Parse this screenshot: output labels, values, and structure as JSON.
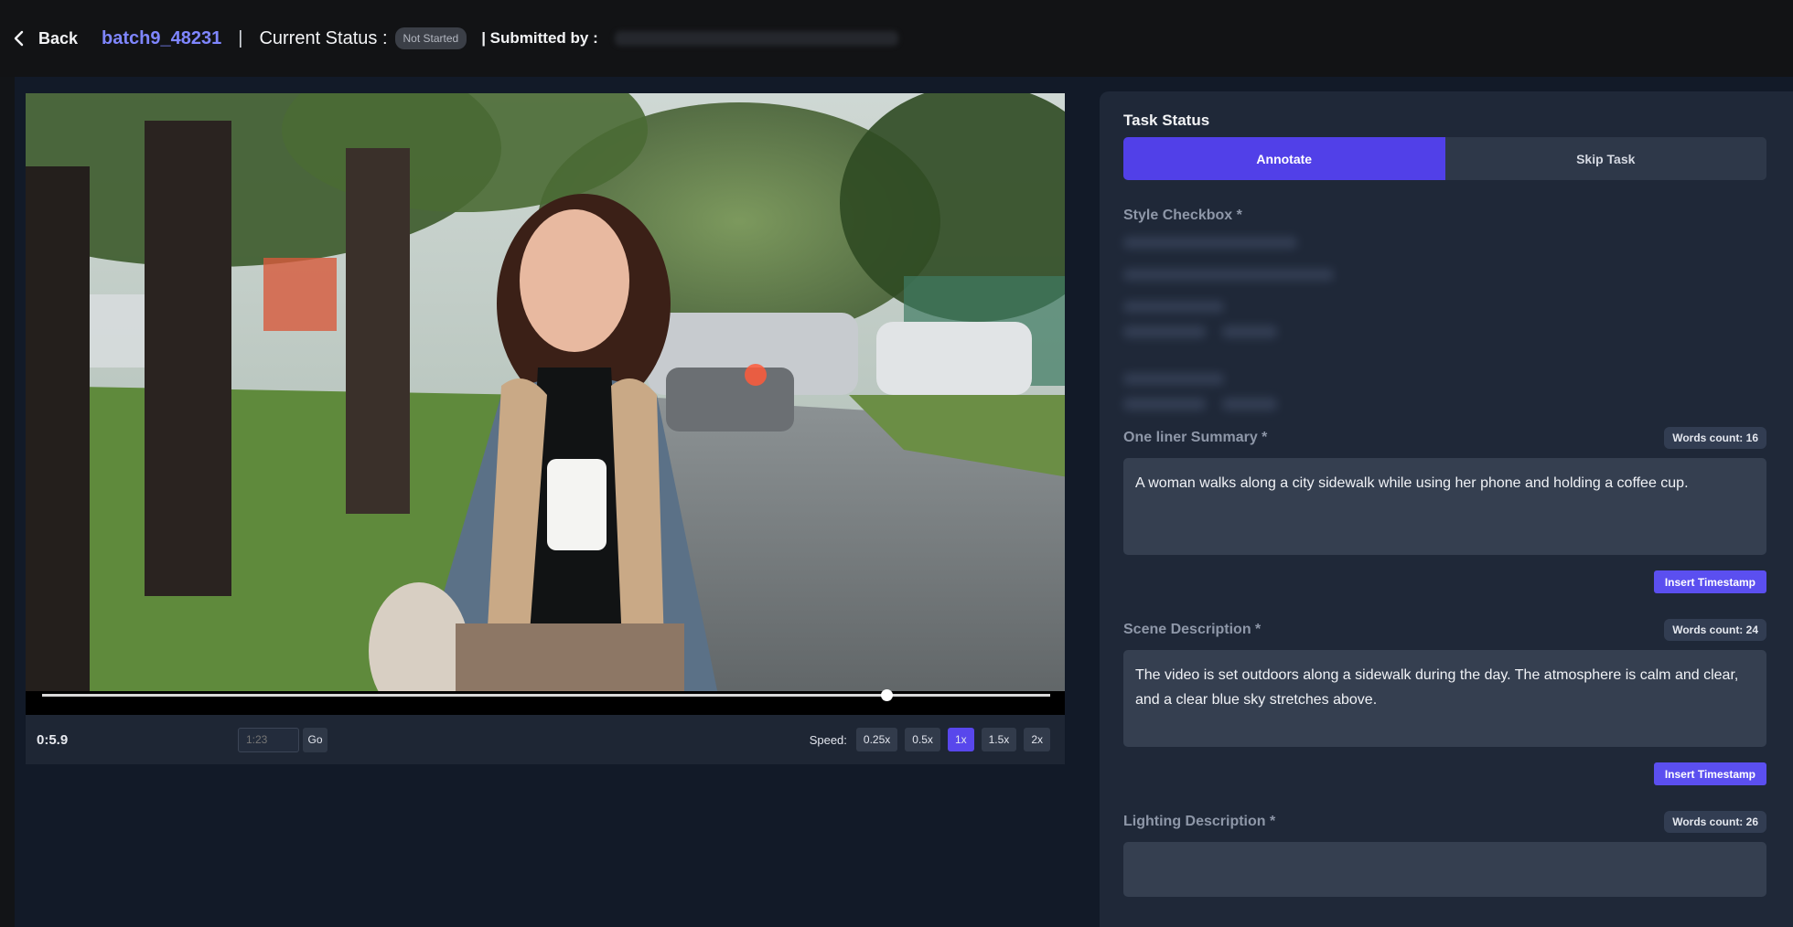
{
  "header": {
    "back_label": "Back",
    "batch_id": "batch9_48231",
    "separator": "|",
    "status_label": "Current Status :",
    "status_value": "Not Started",
    "submitted_label": "| Submitted by :"
  },
  "player": {
    "current_time": "0:5.9",
    "goto_placeholder": "1:23",
    "go_label": "Go",
    "speed_label": "Speed:",
    "speeds": [
      "0.25x",
      "0.5x",
      "1x",
      "1.5x",
      "2x"
    ],
    "active_speed": "1x",
    "progress_fraction": 0.838
  },
  "task": {
    "title": "Task Status",
    "tabs": [
      {
        "label": "Annotate",
        "active": true
      },
      {
        "label": "Skip Task",
        "active": false
      }
    ],
    "style_checkbox_label": "Style Checkbox *",
    "fields": [
      {
        "label": "One liner Summary *",
        "word_count": "Words count: 16",
        "text": "A woman walks along a city sidewalk while using her phone and holding a coffee cup.",
        "button": "Insert Timestamp"
      },
      {
        "label": "Scene Description *",
        "word_count": "Words count: 24",
        "text": "The video is set outdoors along a sidewalk during the day. The atmosphere is calm and clear, and a clear blue sky stretches above.",
        "button": "Insert Timestamp"
      },
      {
        "label": "Lighting Description *",
        "word_count": "Words count: 26"
      }
    ]
  },
  "colors": {
    "accent": "#5140e8",
    "link": "#7f86ff",
    "panel": "#1f2838",
    "page": "#121a28"
  }
}
